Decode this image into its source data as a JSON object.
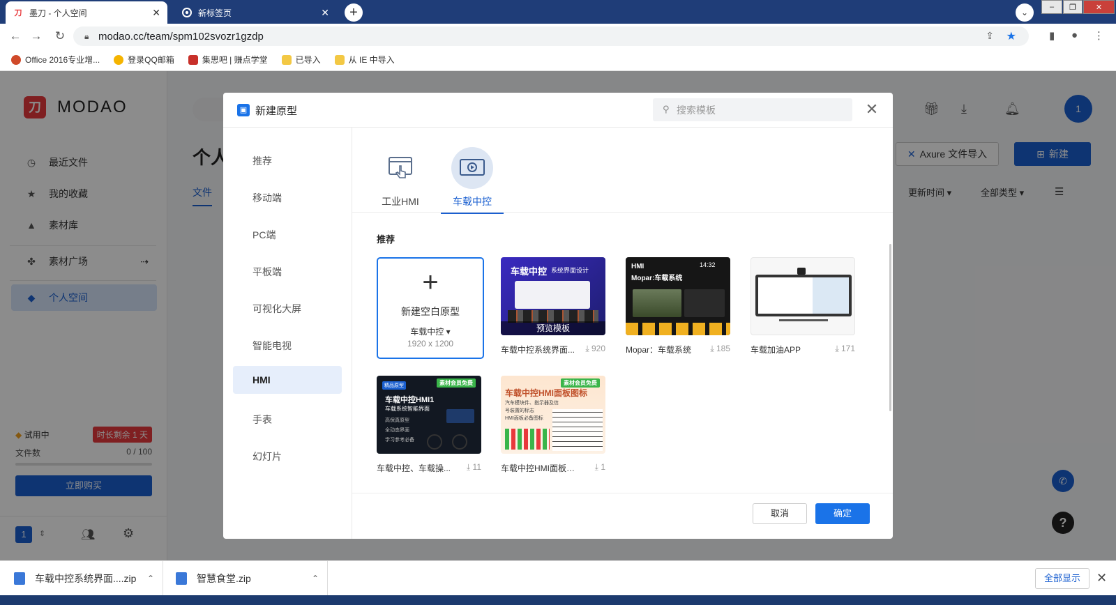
{
  "browser": {
    "tabs": [
      {
        "title": "墨刀 - 个人空间",
        "active": true
      },
      {
        "title": "新标签页",
        "active": false
      }
    ],
    "url": "modao.cc/team/spm102svozr1gzdp",
    "bookmarks": [
      "Office 2016专业增...",
      "登录QQ邮箱",
      "集思吧 | 赚点学堂",
      "已导入",
      "从 IE 中导入"
    ]
  },
  "app": {
    "brand": "MODAO",
    "nav": [
      {
        "label": "最近文件",
        "icon": "clock-icon"
      },
      {
        "label": "我的收藏",
        "icon": "star-icon"
      },
      {
        "label": "素材库",
        "icon": "material-icon"
      },
      {
        "label": "素材广场",
        "icon": "plaza-icon"
      },
      {
        "label": "个人空间",
        "icon": "cube-icon"
      }
    ],
    "trial": {
      "label": "试用中",
      "badge": "时长剩余 1 天",
      "files_label": "文件数",
      "files_count": "0 / 100",
      "buy_label": "立即购买"
    },
    "team_number": "1",
    "page_title": "个人",
    "files_tab": "文件",
    "avatar": "1",
    "axure_import": "Axure 文件导入",
    "new_button": "新建",
    "sort_label": "更新时间",
    "type_filter": "全部类型",
    "help": "?"
  },
  "modal": {
    "title": "新建原型",
    "search_placeholder": "搜索模板",
    "categories": [
      "推荐",
      "移动端",
      "PC端",
      "平板端",
      "可视化大屏",
      "智能电视",
      "HMI",
      "手表",
      "幻灯片"
    ],
    "active_category": "HMI",
    "subtabs": [
      {
        "label": "工业HMI",
        "icon": "touch-screen-icon"
      },
      {
        "label": "车载中控",
        "icon": "car-display-icon"
      }
    ],
    "active_subtab": "车载中控",
    "section_title": "推荐",
    "blank": {
      "title": "新建空白原型",
      "device": "车载中控",
      "size": "1920 x 1200"
    },
    "templates": [
      {
        "name": "车载中控系统界面...",
        "downloads": "920",
        "thumb_title": "车载中控",
        "thumb_sub": "系统界面设计",
        "thumb_overlay": "预览模板",
        "bg": "#2a2a9a"
      },
      {
        "name": "Mopar：车载系统",
        "downloads": "185",
        "thumb_title": "HMI",
        "thumb_sub": "Mopar:车载系统",
        "thumb_time": "14:32",
        "bg": "#1b1b1b"
      },
      {
        "name": "车载加油APP",
        "downloads": "171",
        "bg": "#f4f4f4"
      },
      {
        "name": "车载中控、车载操...",
        "downloads": "11",
        "thumb_tag": "精品原型",
        "thumb_badge": "素材会员免费",
        "thumb_title": "车载中控HMI1",
        "thumb_sub": "车载系统智能界面",
        "thumb_lines": [
          "高保真原型",
          "全动态界面",
          "学习参考必备"
        ],
        "bg": "#141a24"
      },
      {
        "name": "车载中控HMI面板图...",
        "downloads": "1",
        "thumb_badge": "素材会员免费",
        "thumb_title": "车载中控HMI面板图标",
        "thumb_lines": [
          "汽车模块件、指示器及信",
          "号装置的标志",
          "HMI面板必备图标"
        ],
        "bg": "#fde7d6"
      }
    ],
    "cancel": "取消",
    "confirm": "确定"
  },
  "downloads": {
    "items": [
      "车载中控系统界面....zip",
      "智慧食堂.zip"
    ],
    "show_all": "全部显示"
  },
  "colors": {
    "brand_red": "#e8393c",
    "primary_blue": "#1a5fd0",
    "modal_blue": "#1a73e8"
  }
}
